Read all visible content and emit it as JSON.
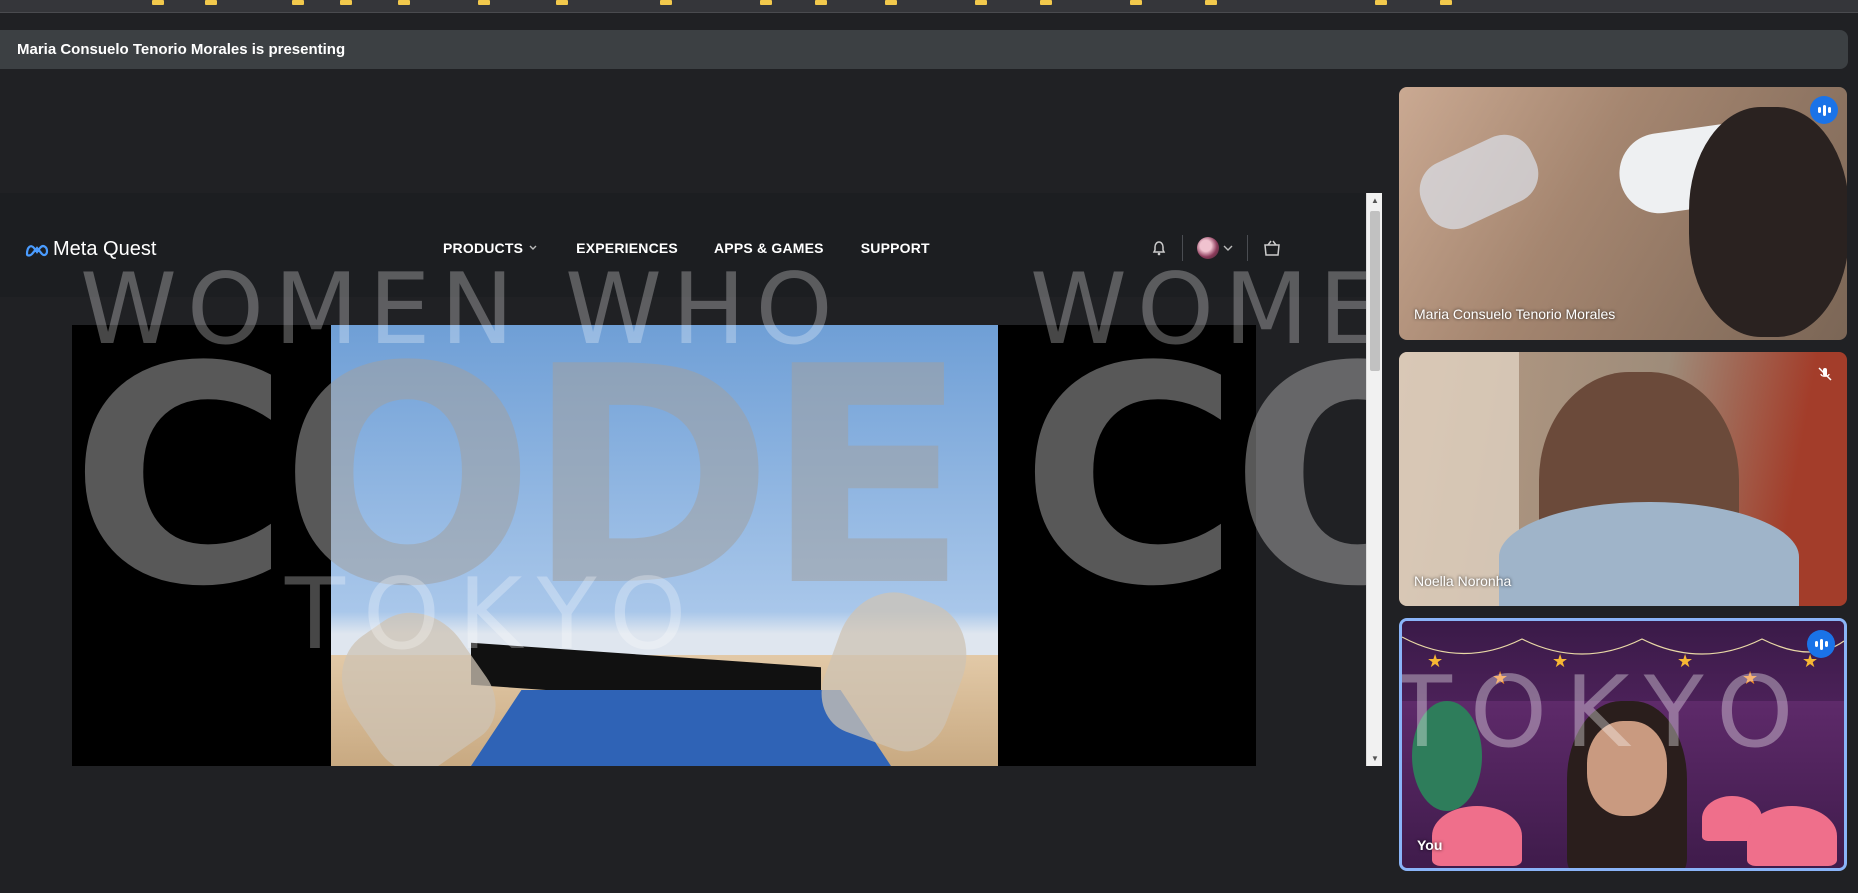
{
  "banner": {
    "text": "Maria Consuelo Tenorio Morales is presenting"
  },
  "shared_screen": {
    "brand": "Meta Quest",
    "nav": {
      "products": "PRODUCTS",
      "experiences": "EXPERIENCES",
      "apps_games": "APPS & GAMES",
      "support": "SUPPORT"
    },
    "icons": [
      "meta-logo-icon",
      "bell-icon",
      "avatar",
      "chevron-down-icon",
      "cart-icon"
    ],
    "watermark": {
      "line1": "WOMEN WHO",
      "line2": "CODE",
      "line3": "TOKYO"
    }
  },
  "participants": [
    {
      "name": "Maria Consuelo Tenorio Morales",
      "state": "speaking"
    },
    {
      "name": "Noella Noronha",
      "state": "muted"
    },
    {
      "name": "You",
      "state": "speaking"
    }
  ],
  "colors": {
    "background": "#202124",
    "banner": "#3c4043",
    "speaking_badge": "#1a73e8",
    "active_tile_border": "#8ab4f8"
  }
}
